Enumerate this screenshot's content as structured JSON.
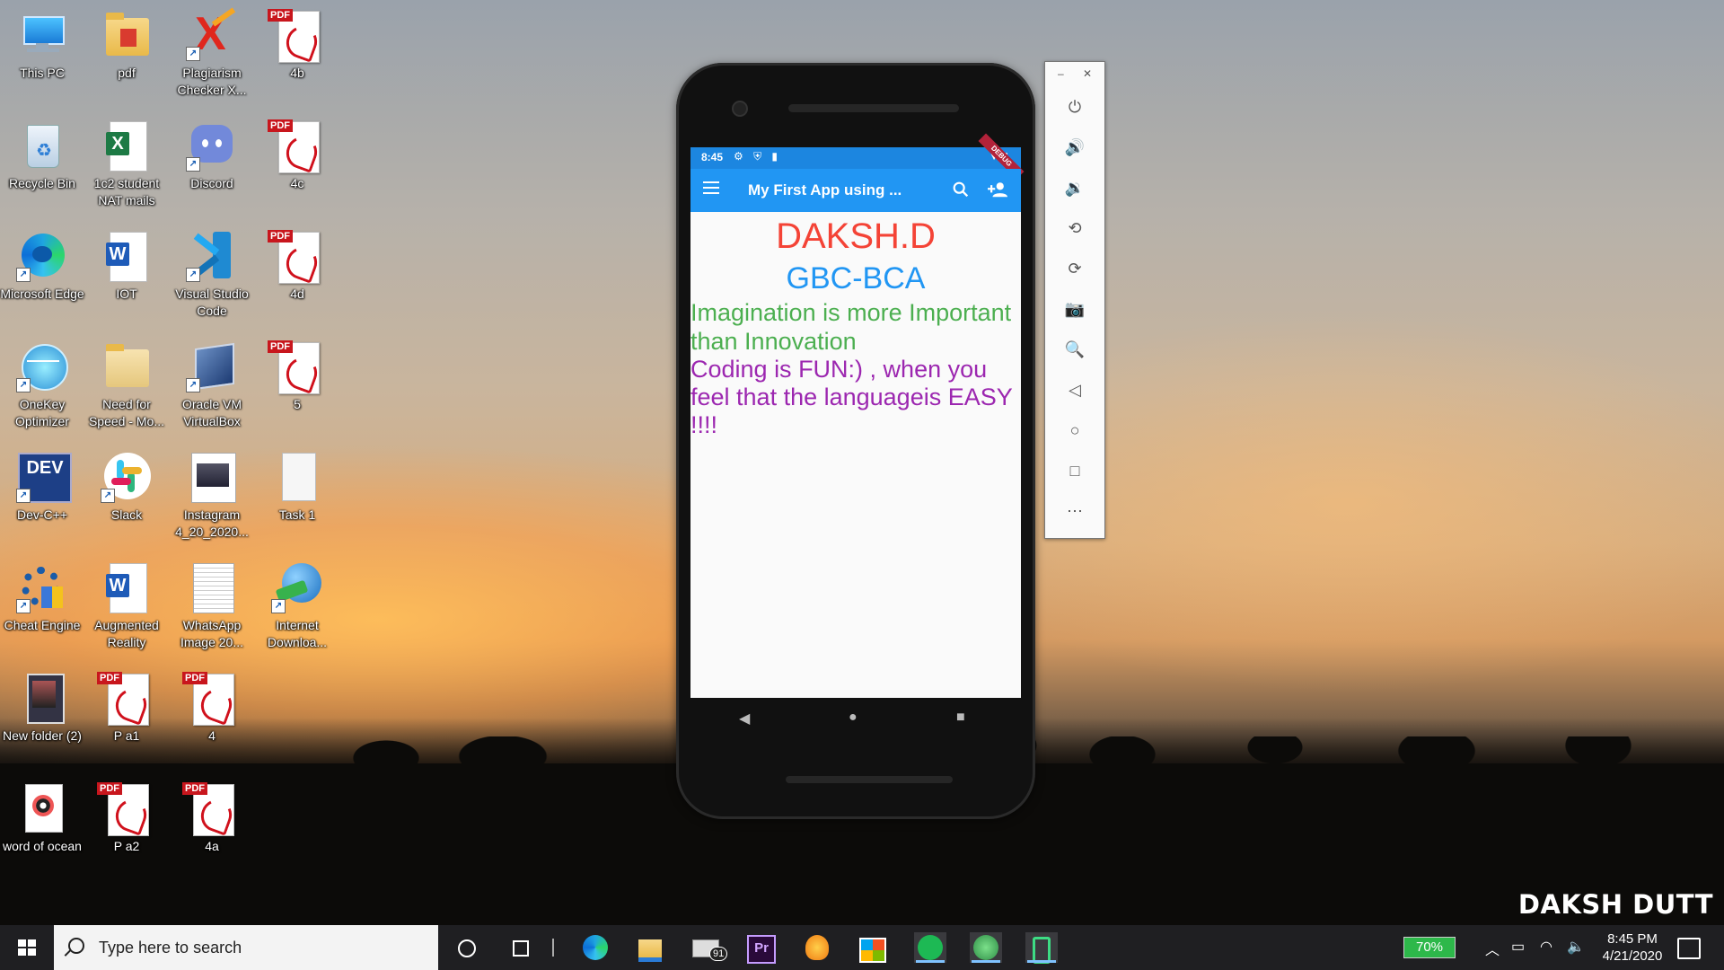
{
  "desktop": {
    "icons": [
      {
        "label": "This PC"
      },
      {
        "label": "pdf"
      },
      {
        "label": "Plagiarism Checker X..."
      },
      {
        "label": "4b"
      },
      {
        "label": "Recycle Bin"
      },
      {
        "label": "1c2 student NAT mails"
      },
      {
        "label": "Discord"
      },
      {
        "label": "4c"
      },
      {
        "label": "Microsoft Edge"
      },
      {
        "label": "IOT"
      },
      {
        "label": "Visual Studio Code"
      },
      {
        "label": "4d"
      },
      {
        "label": "OneKey Optimizer"
      },
      {
        "label": "Need for Speed - Mo..."
      },
      {
        "label": "Oracle VM VirtualBox"
      },
      {
        "label": "5"
      },
      {
        "label": "Dev-C++"
      },
      {
        "label": "Slack"
      },
      {
        "label": "Instagram 4_20_2020..."
      },
      {
        "label": "Task 1"
      },
      {
        "label": "Cheat Engine"
      },
      {
        "label": "Augmented Reality"
      },
      {
        "label": "WhatsApp Image 20..."
      },
      {
        "label": "Internet Downloa..."
      },
      {
        "label": "New folder (2)"
      },
      {
        "label": "P a1"
      },
      {
        "label": "4"
      },
      {
        "label": "word of ocean"
      },
      {
        "label": "P a2"
      },
      {
        "label": "4a"
      }
    ],
    "pdf_tag": "PDF",
    "watermark": "DAKSH DUTT"
  },
  "phone": {
    "status": {
      "time": "8:45",
      "left_icons": "⚙ ⛨ ▮",
      "right_icons": "▼ ▮",
      "debug": "DEBUG"
    },
    "appbar": {
      "title": "My First App using ..."
    },
    "content": {
      "name": "DAKSH.D",
      "college": "GBC-BCA",
      "quote": "Imagination is more Important than Innovation",
      "coding": "Coding is FUN:) , when you feel that the languageis EASY !!!!"
    },
    "nav": {
      "back": "◀",
      "home": "●",
      "recents": "■"
    }
  },
  "emulator_toolbar": {
    "minimize": "–",
    "close": "✕",
    "buttons": [
      "⏻",
      "🔊",
      "🔉",
      "⟲",
      "⟳",
      "📷",
      "🔍",
      "◁",
      "○",
      "□",
      "⋯"
    ]
  },
  "taskbar": {
    "search_placeholder": "Type here to search",
    "mail_badge": "91",
    "battery": "70%",
    "time": "8:45 PM",
    "date": "4/21/2020"
  },
  "colors": {
    "appbar": "#2196f3",
    "statusbar": "#1c86e0",
    "name": "#f44336",
    "college": "#2196f3",
    "quote": "#4caf50",
    "coding": "#9c27b0"
  }
}
